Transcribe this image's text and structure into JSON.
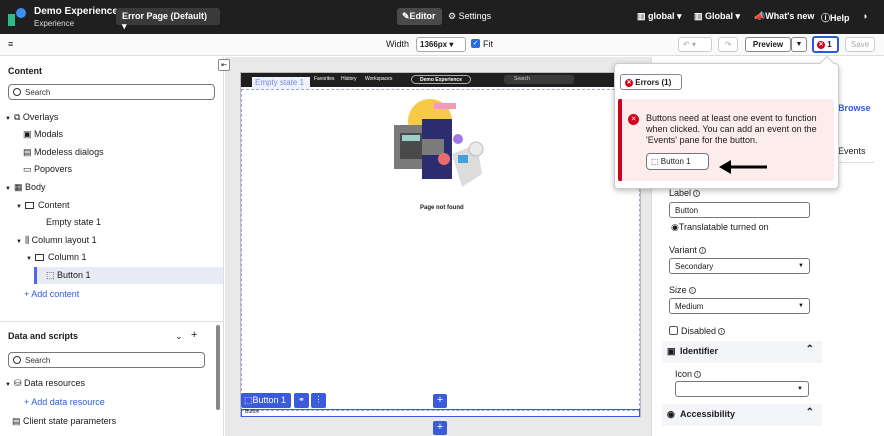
{
  "topbar": {
    "app_title": "Demo Experience",
    "app_subtitle": "Experience",
    "page_select": "Error Page (Default)",
    "editor_tab": "Editor",
    "settings_tab": "Settings",
    "scope_global_lower": "global",
    "scope_global": "Global",
    "whats_new": "What's new",
    "help": "Help"
  },
  "toolbar": {
    "width_label": "Width",
    "width_value": "1366px",
    "fit_label": "Fit",
    "preview": "Preview",
    "errors_count": "1",
    "save": "Save"
  },
  "left": {
    "content_title": "Content",
    "search_placeholder": "Search",
    "overlays": "Overlays",
    "modals": "Modals",
    "modeless_dialogs": "Modeless dialogs",
    "popovers": "Popovers",
    "body": "Body",
    "content": "Content",
    "empty_state": "Empty state 1",
    "column_layout": "Column layout 1",
    "column": "Column 1",
    "button": "Button 1",
    "add_content": "Add content",
    "data_scripts_title": "Data and scripts",
    "search2_placeholder": "Search",
    "data_resources": "Data resources",
    "add_data_resource": "Add data resource",
    "client_state": "Client state parameters"
  },
  "canvas": {
    "nav_favorites": "Favorites",
    "nav_history": "History",
    "nav_workspaces": "Workspaces",
    "nav_pill": "Demo Experience",
    "nav_search": "Search",
    "empty_tag": "Empty state 1",
    "page_not_found": "Page not found",
    "selected_button": "Button 1",
    "outline_label": "Button"
  },
  "right": {
    "browse": "Browse",
    "events_tab": "Events",
    "label_label": "Label",
    "label_value": "Button",
    "translatable": "Translatable turned on",
    "variant_label": "Variant",
    "variant_value": "Secondary",
    "size_label": "Size",
    "size_value": "Medium",
    "disabled_label": "Disabled",
    "identifier": "Identifier",
    "icon_label": "Icon",
    "accessibility": "Accessibility"
  },
  "popover": {
    "errors_tab": "Errors (1)",
    "message": "Buttons need at least one event to function when clicked. You can add an event on the 'Events' pane for the button.",
    "chip_label": "Button 1"
  }
}
